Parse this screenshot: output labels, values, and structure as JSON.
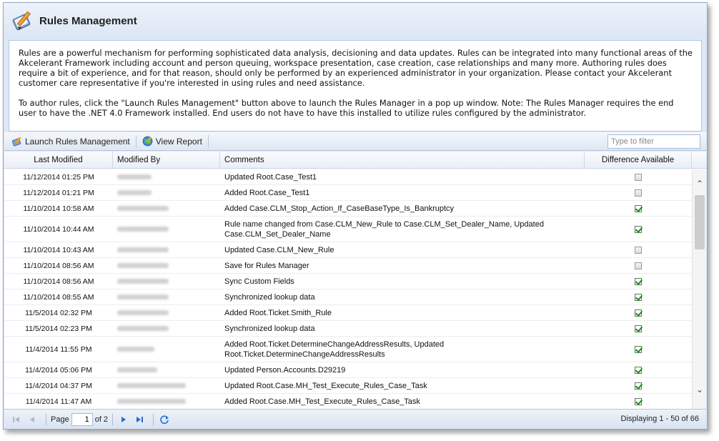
{
  "window": {
    "title": "Rules Management",
    "icon": "rules-book-pencil-icon"
  },
  "description": {
    "paragraph1": "Rules are a powerful mechanism for performing sophisticated data analysis, decisioning and data updates. Rules can be integrated into many functional areas of the Akcelerant Framework including account and person queuing, workspace presentation, case creation, case relationships and many more. Authoring rules does require a bit of experience, and for that reason, should only be performed by an experienced administrator in your organization. Please contact your Akcelerant customer care representative if you're interested in using rules and need assistance.",
    "paragraph2": "To author rules, click the \"Launch Rules Management\" button above to launch the Rules Manager in a pop up window. Note: The Rules Manager requires the end user to have the .NET 4.0 Framework installed. End users do not have to have this installed to utilize rules configured by the administrator."
  },
  "toolbar": {
    "launch_label": "Launch Rules Management",
    "report_label": "View Report",
    "filter_placeholder": "Type to filter",
    "filter_value": ""
  },
  "grid": {
    "columns": [
      "Last Modified",
      "Modified By",
      "Comments",
      "Difference Available"
    ],
    "rows": [
      {
        "date": "11/12/2014 01:25 PM",
        "by_blur": 48,
        "comment": "Updated Root.Case_Test1",
        "diff": false
      },
      {
        "date": "11/12/2014 01:21 PM",
        "by_blur": 48,
        "comment": "Added Root.Case_Test1",
        "diff": false
      },
      {
        "date": "11/10/2014 10:58 AM",
        "by_blur": 72,
        "comment": "Added Case.CLM_Stop_Action_If_CaseBaseType_Is_Bankruptcy",
        "diff": true
      },
      {
        "date": "11/10/2014 10:44 AM",
        "by_blur": 72,
        "comment": "Rule name changed from Case.CLM_New_Rule to Case.CLM_Set_Dealer_Name, Updated Case.CLM_Set_Dealer_Name",
        "diff": true,
        "tall": true
      },
      {
        "date": "11/10/2014 10:43 AM",
        "by_blur": 72,
        "comment": "Updated Case.CLM_New_Rule",
        "diff": false
      },
      {
        "date": "11/10/2014 08:56 AM",
        "by_blur": 72,
        "comment": "Save for Rules Manager",
        "diff": false
      },
      {
        "date": "11/10/2014 08:56 AM",
        "by_blur": 72,
        "comment": "Sync Custom Fields",
        "diff": true
      },
      {
        "date": "11/10/2014 08:55 AM",
        "by_blur": 72,
        "comment": "Synchronized lookup data",
        "diff": true
      },
      {
        "date": "11/5/2014 02:32 PM",
        "by_blur": 72,
        "comment": "Added Root.Ticket.Smith_Rule",
        "diff": true
      },
      {
        "date": "11/5/2014 02:23 PM",
        "by_blur": 72,
        "comment": "Synchronized lookup data",
        "diff": true
      },
      {
        "date": "11/4/2014 11:55 PM",
        "by_blur": 52,
        "comment": "Added Root.Ticket.DetermineChangeAddressResults, Updated Root.Ticket.DetermineChangeAddressResults",
        "diff": true,
        "tall": true
      },
      {
        "date": "11/4/2014 05:06 PM",
        "by_blur": 56,
        "comment": "Updated Person.Accounts.D29219",
        "diff": true
      },
      {
        "date": "11/4/2014 04:37 PM",
        "by_blur": 96,
        "comment": "Updated Root.Case.MH_Test_Execute_Rules_Case_Task",
        "diff": true
      },
      {
        "date": "11/4/2014 11:47 AM",
        "by_blur": 96,
        "comment": "Added Root.Case.MH_Test_Execute_Rules_Case_Task",
        "diff": true
      }
    ]
  },
  "pager": {
    "page_label": "Page",
    "page_value": "1",
    "of_label": "of 2",
    "displaying": "Displaying 1 - 50 of 66"
  },
  "colors": {
    "window_bg": "#dfe8f6",
    "border": "#8fa7c6",
    "check_green": "#1f8a1f"
  }
}
